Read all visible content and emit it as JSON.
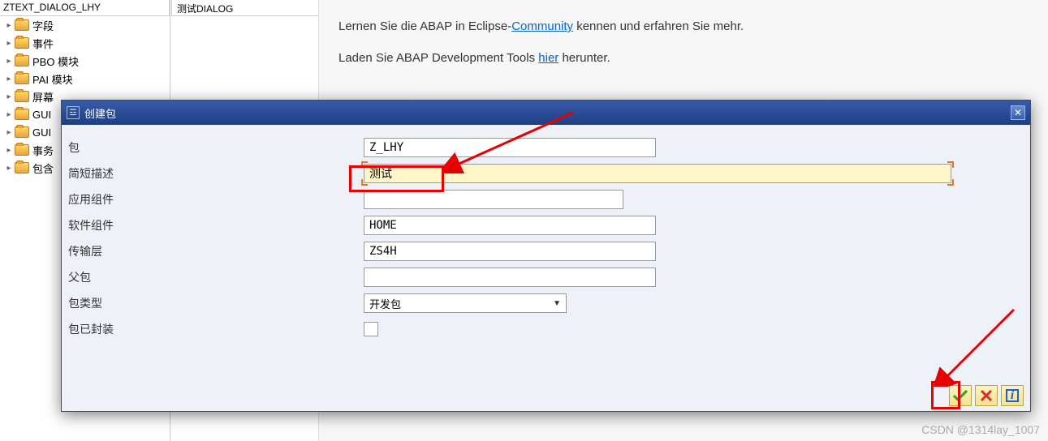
{
  "sidebar": {
    "header_name": "ZTEXT_DIALOG_LHY",
    "header_desc": "测试DIALOG",
    "items": [
      {
        "label": "字段"
      },
      {
        "label": "事件"
      },
      {
        "label": "PBO 模块"
      },
      {
        "label": "PAI 模块"
      },
      {
        "label": "屏幕"
      },
      {
        "label": "GUI"
      },
      {
        "label": "GUI"
      },
      {
        "label": "事务"
      },
      {
        "label": "包含"
      }
    ]
  },
  "content": {
    "line1_pre": "Lernen Sie die ABAP in Eclipse-",
    "line1_link": "Community",
    "line1_post": " kennen und erfahren Sie mehr.",
    "line2_pre": "Laden Sie ABAP Development Tools ",
    "line2_link": "hier",
    "line2_post": " herunter."
  },
  "dialog": {
    "title": "创建包",
    "fields": {
      "package_label": "包",
      "package_value": "Z_LHY",
      "shortdesc_label": "简短描述",
      "shortdesc_value": "测试",
      "appcomp_label": "应用组件",
      "appcomp_value": "",
      "softcomp_label": "软件组件",
      "softcomp_value": "HOME",
      "transport_label": "传输层",
      "transport_value": "ZS4H",
      "parentpkg_label": "父包",
      "parentpkg_value": "",
      "pkgtype_label": "包类型",
      "pkgtype_value": "开发包",
      "sealed_label": "包已封装"
    },
    "buttons": {
      "ok": "✔",
      "cancel": "✖",
      "info": "i"
    }
  },
  "watermark": "CSDN @1314lay_1007"
}
